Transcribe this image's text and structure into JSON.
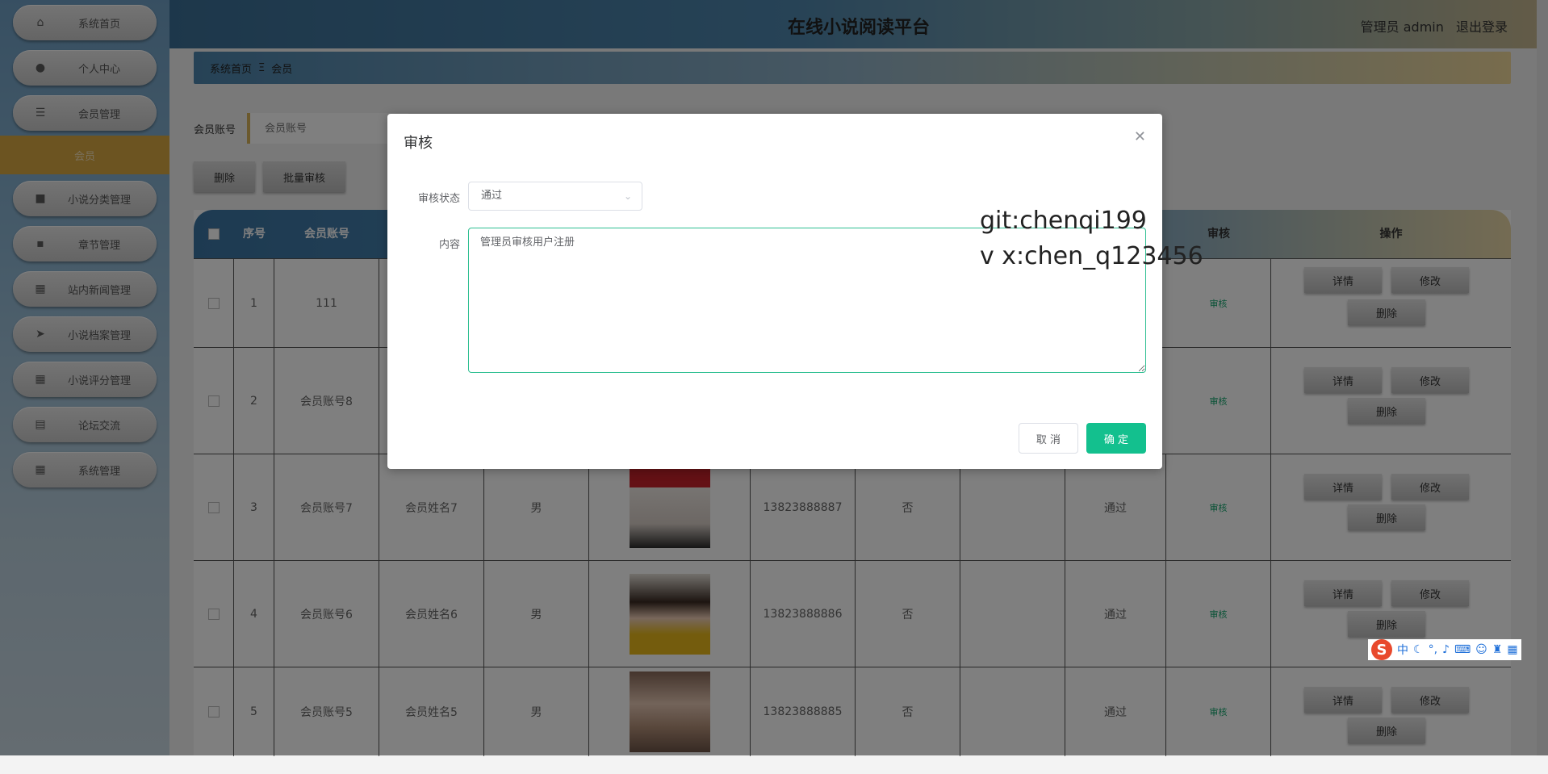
{
  "sidebar": {
    "items": [
      {
        "label": "系统首页",
        "icon": "home-icon"
      },
      {
        "label": "个人中心",
        "icon": "user-icon"
      },
      {
        "label": "会员管理",
        "icon": "menu-icon"
      },
      {
        "label": "小说分类管理",
        "icon": "video-icon"
      },
      {
        "label": "章节管理",
        "icon": "chat-icon"
      },
      {
        "label": "站内新闻管理",
        "icon": "grid-icon"
      },
      {
        "label": "小说档案管理",
        "icon": "send-icon"
      },
      {
        "label": "小说评分管理",
        "icon": "grid-icon"
      },
      {
        "label": "论坛交流",
        "icon": "doc-icon"
      },
      {
        "label": "系统管理",
        "icon": "grid-icon"
      }
    ],
    "submenu": "会员"
  },
  "header": {
    "title": "在线小说阅读平台",
    "user": "管理员 admin",
    "logout": "退出登录"
  },
  "breadcrumb": {
    "home": "系统首页",
    "sep": "Ξ",
    "current": "会员"
  },
  "search": {
    "label": "会员账号",
    "placeholder": "会员账号"
  },
  "toolbar": {
    "delete": "删除",
    "batch_review": "批量审核"
  },
  "table": {
    "headers": {
      "no": "序号",
      "account": "会员账号",
      "review": "审核",
      "ops": "操作"
    },
    "rows": [
      {
        "no": "1",
        "account": "111",
        "name": "",
        "gender": "",
        "phone": "",
        "vip": "",
        "status": "",
        "review": "审核"
      },
      {
        "no": "2",
        "account": "会员账号8",
        "name": "",
        "gender": "",
        "phone": "",
        "vip": "",
        "status": "",
        "review": "审核"
      },
      {
        "no": "3",
        "account": "会员账号7",
        "name": "会员姓名7",
        "gender": "男",
        "phone": "13823888887",
        "vip": "否",
        "status": "通过",
        "review": "审核"
      },
      {
        "no": "4",
        "account": "会员账号6",
        "name": "会员姓名6",
        "gender": "男",
        "phone": "13823888886",
        "vip": "否",
        "status": "通过",
        "review": "审核"
      },
      {
        "no": "5",
        "account": "会员账号5",
        "name": "会员姓名5",
        "gender": "男",
        "phone": "13823888885",
        "vip": "否",
        "status": "通过",
        "review": "审核"
      }
    ],
    "row_buttons": {
      "detail": "详情",
      "edit": "修改",
      "delete": "删除"
    }
  },
  "dialog": {
    "title": "审核",
    "status_label": "审核状态",
    "status_value": "通过",
    "content_label": "内容",
    "content_value": "管理员审核用户注册",
    "cancel": "取 消",
    "confirm": "确 定"
  },
  "watermark": {
    "line1": "git:chenqi199",
    "line2": "v x:chen_q123456"
  },
  "ime": {
    "mode": "中"
  }
}
